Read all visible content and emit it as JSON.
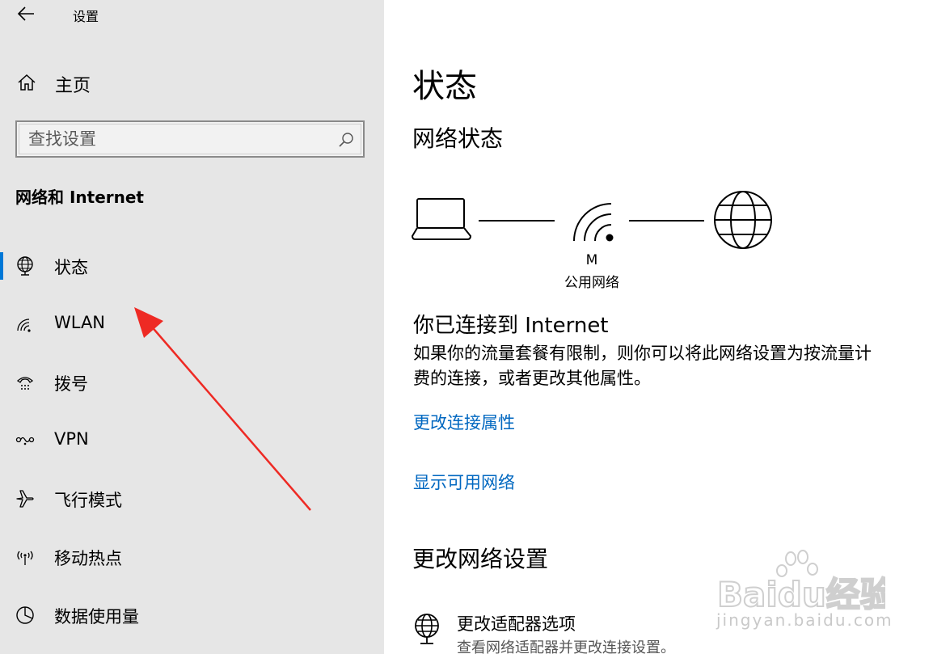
{
  "app": {
    "title": "设置"
  },
  "sidebar": {
    "home_label": "主页",
    "search": {
      "placeholder": "查找设置",
      "value": ""
    },
    "section_title": "网络和 Internet",
    "items": [
      {
        "label": "状态",
        "icon": "globe-pc-icon",
        "active": true
      },
      {
        "label": "WLAN",
        "icon": "wifi-icon",
        "active": false
      },
      {
        "label": "拨号",
        "icon": "dialup-icon",
        "active": false
      },
      {
        "label": "VPN",
        "icon": "vpn-icon",
        "active": false
      },
      {
        "label": "飞行模式",
        "icon": "airplane-icon",
        "active": false
      },
      {
        "label": "移动热点",
        "icon": "hotspot-icon",
        "active": false
      },
      {
        "label": "数据使用量",
        "icon": "data-usage-icon",
        "active": false
      }
    ]
  },
  "main": {
    "title": "状态",
    "network_status_heading": "网络状态",
    "network": {
      "name": "M",
      "type": "公用网络"
    },
    "connected_text": "你已连接到 Internet",
    "description_line1": "如果你的流量套餐有限制，则你可以将此网络设置为按流量计",
    "description_line2": "费的连接，或者更改其他属性。",
    "links": {
      "change_properties": "更改连接属性",
      "show_networks": "显示可用网络"
    },
    "change_settings_heading": "更改网络设置",
    "adapter": {
      "title": "更改适配器选项",
      "description": "查看网络适配器并更改连接设置。"
    }
  },
  "watermark": {
    "brand": "Baidu经验",
    "sub": "jingyan.baidu.com"
  },
  "colors": {
    "accent": "#0078d7",
    "link": "#0067c0",
    "sidebar_bg": "#e6e6e6",
    "annotation_arrow": "#ee2a24"
  }
}
